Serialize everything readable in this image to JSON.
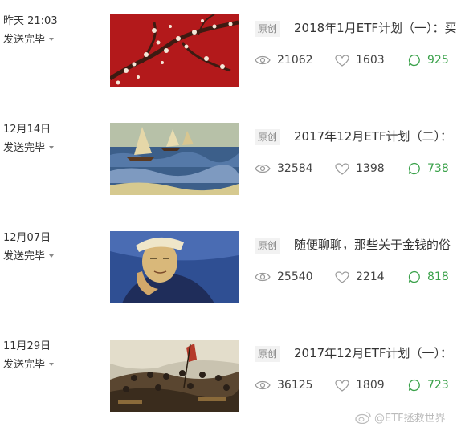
{
  "articles": [
    {
      "date": "昨天 21:03",
      "status": "发送完毕",
      "badge": "原创",
      "title": "2018年1月ETF计划（一）：买",
      "views": "21062",
      "likes": "1603",
      "comments": "925",
      "thumbnail": "almond-blossom-painting"
    },
    {
      "date": "12月14日",
      "status": "发送完毕",
      "badge": "原创",
      "title": "2017年12月ETF计划（二）：",
      "views": "32584",
      "likes": "1398",
      "comments": "738",
      "thumbnail": "seascape-sailboats-painting"
    },
    {
      "date": "12月07日",
      "status": "发送完毕",
      "badge": "原创",
      "title": "随便聊聊，那些关于金钱的俗",
      "views": "25540",
      "likes": "2214",
      "comments": "818",
      "thumbnail": "portrait-dr-gachet-painting"
    },
    {
      "date": "11月29日",
      "status": "发送完毕",
      "badge": "原创",
      "title": "2017年12月ETF计划（一）：",
      "views": "36125",
      "likes": "1809",
      "comments": "723",
      "thumbnail": "battle-scene-painting"
    }
  ],
  "watermark": "@ETF拯救世界",
  "colors": {
    "comment_green": "#3aa14a",
    "text": "#333333",
    "muted": "#888888"
  }
}
